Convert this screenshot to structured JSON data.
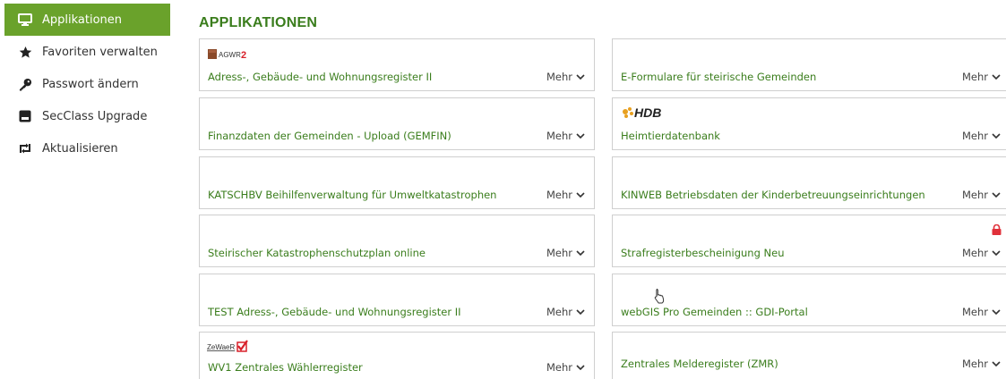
{
  "sidebar": {
    "items": [
      {
        "label": "Applikationen",
        "icon": "monitor-icon",
        "active": true
      },
      {
        "label": "Favoriten verwalten",
        "icon": "star-icon",
        "active": false
      },
      {
        "label": "Passwort ändern",
        "icon": "key-icon",
        "active": false
      },
      {
        "label": "SecClass Upgrade",
        "icon": "secclass-icon",
        "active": false
      },
      {
        "label": "Aktualisieren",
        "icon": "refresh-icon",
        "active": false
      }
    ]
  },
  "main": {
    "title": "APPLIKATIONEN",
    "more_label": "Mehr",
    "apps": [
      {
        "title": "Adress-, Gebäude- und Wohnungsregister II",
        "logo": "AGWR2"
      },
      {
        "title": "E-Formulare für steirische Gemeinden"
      },
      {
        "title": "Finanzdaten der Gemeinden - Upload (GEMFIN)"
      },
      {
        "title": "Heimtierdatenbank",
        "logo": "HDB"
      },
      {
        "title": "KATSCHBV Beihilfenverwaltung für Umweltkatastrophen"
      },
      {
        "title": "KINWEB Betriebsdaten der Kinderbetreuungseinrichtungen"
      },
      {
        "title": "Steirischer Katastrophenschutzplan online"
      },
      {
        "title": "Strafregisterbescheinigung Neu",
        "locked": true
      },
      {
        "title": "TEST Adress-, Gebäude- und Wohnungsregister II"
      },
      {
        "title": "webGIS Pro Gemeinden :: GDI-Portal"
      },
      {
        "title": "WV1 Zentrales Wählerregister",
        "logo": "ZeWaeR"
      },
      {
        "title": "Zentrales Melderegister (ZMR)"
      }
    ]
  },
  "colors": {
    "accent": "#6aa22b",
    "link": "#3a7d1c",
    "lock": "#e0303a"
  }
}
